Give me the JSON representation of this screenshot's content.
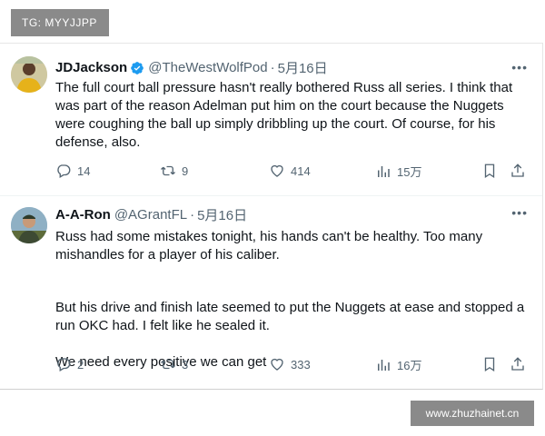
{
  "watermark_top": "TG: MYYJJPP",
  "watermark_bottom": "www.zhuzhainet.cn",
  "tweets": [
    {
      "name": "JDJackson",
      "verified": true,
      "handle": "@TheWestWolfPod",
      "date": "5月16日",
      "text": "The full court ball pressure hasn't really bothered Russ all series. I think that was part of the reason Adelman put him on the court because the Nuggets were coughing the ball up simply dribbling up the court. Of course, for his defense, also.",
      "replies": "14",
      "retweets": "9",
      "likes": "414",
      "views": "15万"
    },
    {
      "name": "A-A-Ron",
      "verified": false,
      "handle": "@AGrantFL",
      "date": "5月16日",
      "paragraphs": [
        "Russ had some mistakes tonight, his hands can't be healthy.  Too many mishandles for a player of his caliber.",
        "But his drive and finish late seemed to put the Nuggets at ease and stopped a run OKC had. I felt like he sealed it.",
        "We need every positive we can get"
      ],
      "replies": "2",
      "retweets": "3",
      "likes": "333",
      "views": "16万"
    }
  ],
  "colors": {
    "text": "#0f1419",
    "secondary": "#536471",
    "verified": "#1d9bf0",
    "watermark_bg": "#8a8a8a"
  },
  "icons": [
    "reply-icon",
    "retweet-icon",
    "like-icon",
    "views-icon",
    "bookmark-icon",
    "share-icon",
    "more-icon",
    "verified-icon"
  ]
}
